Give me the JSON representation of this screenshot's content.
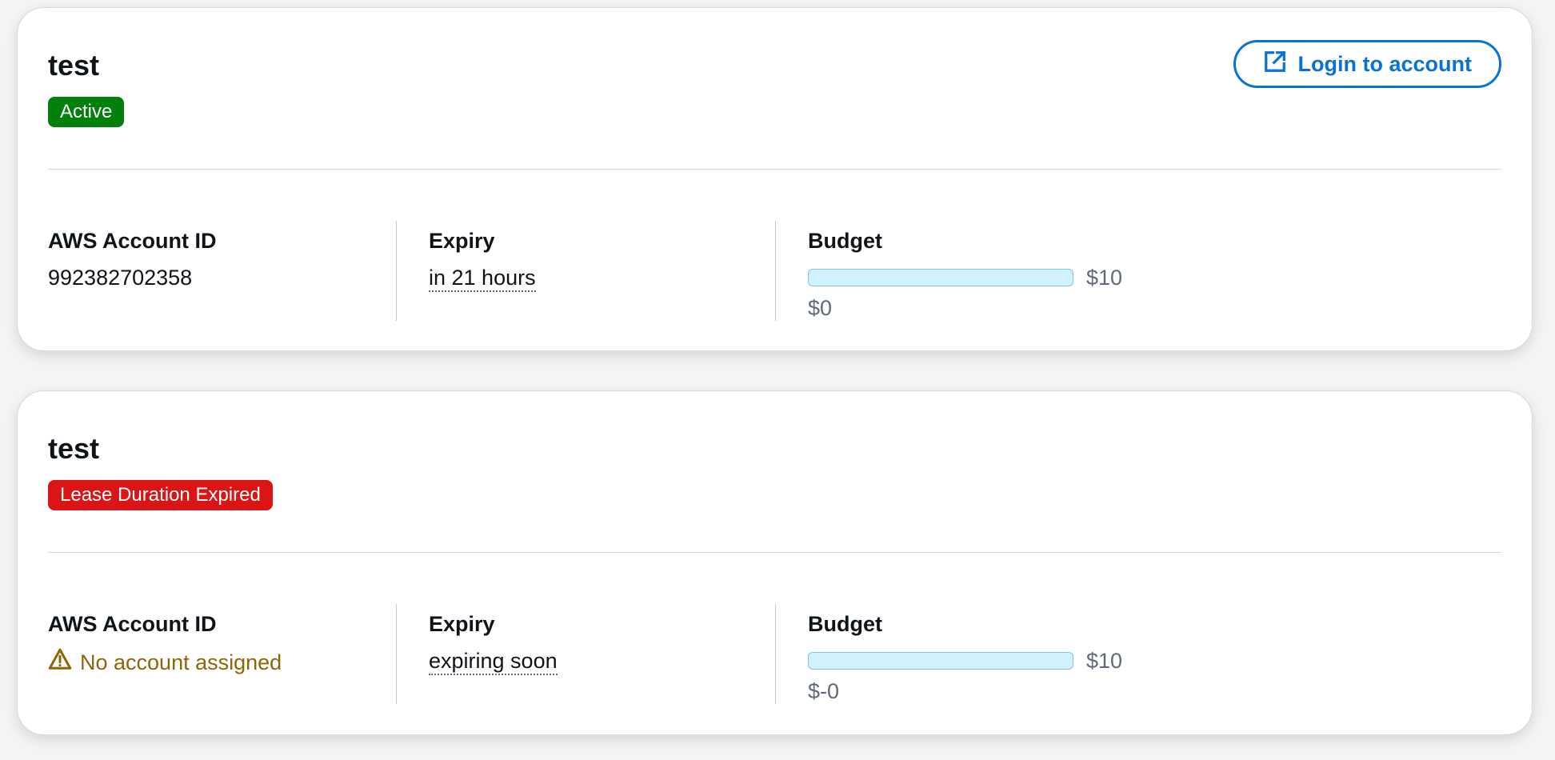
{
  "leases": [
    {
      "name": "test",
      "status": "Active",
      "status_type": "success",
      "login_button_label": "Login to account",
      "account_id_label": "AWS Account ID",
      "account_id": "992382702358",
      "expiry_label": "Expiry",
      "expiry": "in 21 hours",
      "budget_label": "Budget",
      "budget_max": "$10",
      "budget_used": "$0",
      "budget_progress_fraction": 0
    },
    {
      "name": "test",
      "status": "Lease Duration Expired",
      "status_type": "error",
      "account_id_label": "AWS Account ID",
      "account_warning": "No account assigned",
      "expiry_label": "Expiry",
      "expiry": "expiring soon",
      "budget_label": "Budget",
      "budget_max": "$10",
      "budget_used": "$-0",
      "budget_progress_fraction": 0
    }
  ],
  "icons": {
    "external_link": "external-link-icon",
    "warning": "warning-icon"
  },
  "colors": {
    "success": "#037f0c",
    "error": "#d91515",
    "link": "#0972d3",
    "warning_text": "#8d6605",
    "progress_track": "#d1f1ff"
  }
}
